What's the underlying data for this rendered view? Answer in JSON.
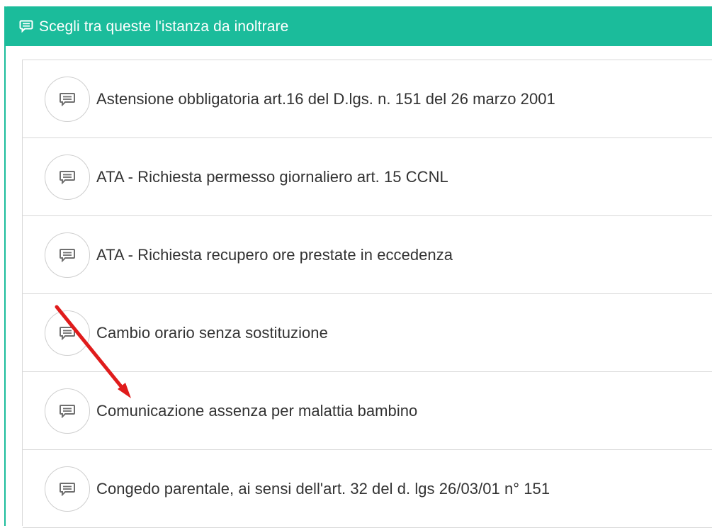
{
  "panel": {
    "header_icon": "message-square-icon",
    "title": "Scegli tra queste l'istanza da inoltrare"
  },
  "list": {
    "item_icon": "message-square-icon",
    "items": [
      {
        "label": "Astensione obbligatoria art.16 del D.lgs. n. 151 del 26 marzo 2001"
      },
      {
        "label": "ATA - Richiesta permesso giornaliero art. 15 CCNL"
      },
      {
        "label": "ATA - Richiesta recupero ore prestate in eccedenza"
      },
      {
        "label": "Cambio orario senza sostituzione"
      },
      {
        "label": "Comunicazione assenza per malattia bambino"
      },
      {
        "label": "Congedo parentale, ai sensi dell'art. 32 del d. lgs 26/03/01 n° 151"
      }
    ]
  },
  "colors": {
    "accent": "#1bbc9b",
    "annotation_arrow": "#e01b1b",
    "item_text": "#333333",
    "divider": "#d8d8d8"
  }
}
